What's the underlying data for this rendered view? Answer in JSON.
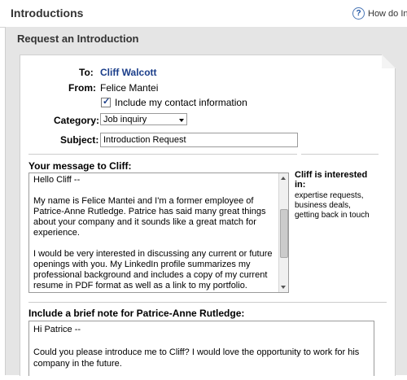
{
  "header": {
    "title": "Introductions",
    "help_icon": "?",
    "help_text": "How do Int"
  },
  "section": {
    "title": "Request an Introduction"
  },
  "form": {
    "to_label": "To:",
    "to_value": "Cliff Walcott",
    "from_label": "From:",
    "from_value": "Felice Mantei",
    "include_contact_label": "Include my contact information",
    "include_contact_checked": true,
    "category_label": "Category:",
    "category_value": "Job inquiry",
    "subject_label": "Subject:",
    "subject_value": "Introduction Request"
  },
  "message": {
    "label": "Your message to Cliff:",
    "paragraphs": [
      "Hello Cliff --",
      "My name is Felice Mantei and I'm a former employee of Patrice-Anne Rutledge. Patrice has said many great things about your company and it sounds like a great match for experience.",
      "I would be very interested in discussing any current or future openings with you. My LinkedIn profile summarizes my professional background and includes a copy of my current resume in PDF format as well as a link to my portfolio."
    ]
  },
  "interest": {
    "title": "Cliff is interested in:",
    "text": "expertise requests, business deals, getting back in touch"
  },
  "note": {
    "label": "Include a brief note for Patrice-Anne Rutledge:",
    "paragraphs": [
      "Hi Patrice --",
      "Could you please introduce me to Cliff? I would love the opportunity to work for his company in the future."
    ]
  }
}
